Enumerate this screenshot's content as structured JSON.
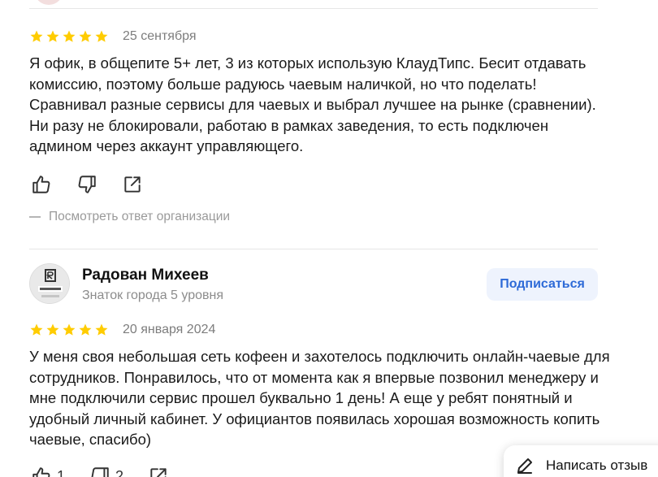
{
  "prev_review": {
    "rating": 5,
    "date": "25 сентября",
    "text": "Я офик, в общепите 5+ лет, 3 из которых использую КлаудТипс. Бесит отдавать комиссию, поэтому больше радуюсь чаевым наличкой, но что поделать! Сравнивал разные сервисы для чаевых и выбрал лучшее на рынке (сравнении). Ни разу не блокировали, работаю в рамках заведения, то есть подключен админом через аккаунт управляющего.",
    "org_reply_link": "Посмотреть ответ организации"
  },
  "review": {
    "author_name": "Радован Михеев",
    "author_level": "Знаток города 5 уровня",
    "subscribe_label": "Подписаться",
    "rating": 5,
    "date": "20 января 2024",
    "text": "У меня своя небольшая сеть кофеен и захотелось подключить онлайн-чаевые для сотрудников. Понравилось, что от момента как я впервые позвонил менеджеру и мне подключили сервис прошел буквально 1 день! А еще у ребят понятный и удобный личный кабинет. У официантов появилась хорошая возможность копить чаевые, спасибо)",
    "likes": "1",
    "dislikes": "2"
  },
  "write_review_label": "Написать отзыв",
  "colors": {
    "star": "#fc0",
    "accent": "#2d6ad7",
    "subscribe_bg": "#eef3fd",
    "muted": "#8c8c8c"
  },
  "icons": [
    "star-icon",
    "like-icon",
    "dislike-icon",
    "share-icon",
    "pencil-icon"
  ]
}
